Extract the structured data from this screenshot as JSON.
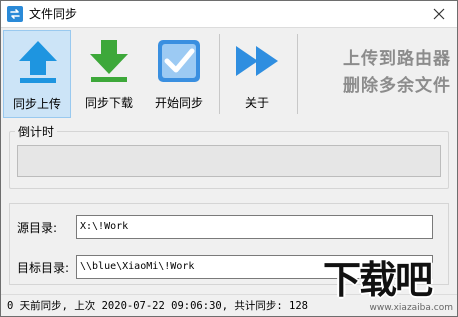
{
  "window": {
    "title": "文件同步"
  },
  "toolbar": {
    "items": [
      {
        "label": "同步上传",
        "icon": "upload-arrow-icon",
        "active": true
      },
      {
        "label": "同步下载",
        "icon": "download-arrow-icon"
      },
      {
        "label": "开始同步",
        "icon": "check-box-icon"
      },
      {
        "label": "关于",
        "icon": "fast-forward-icon"
      }
    ],
    "banner": [
      "上传到路由器",
      "删除多余文件"
    ]
  },
  "countdown": {
    "label": "倒计时",
    "progress": 0
  },
  "paths": {
    "source_label": "源目录:",
    "source_value": "X:\\!Work",
    "target_label": "目标目录:",
    "target_value": "\\\\blue\\XiaoMi\\!Work"
  },
  "status": {
    "text": "0 天前同步, 上次 2020-07-22 09:06:30, 共计同步: 128"
  },
  "watermark": {
    "glyphs": "下载吧",
    "url": "www.xiazaiba.com"
  },
  "colors": {
    "accent_blue": "#2a8ad8",
    "download_green": "#3da83a",
    "check_blue": "#3a8fe0",
    "banner_gray": "#8c8c8c",
    "active_bg": "#cce4f7"
  }
}
